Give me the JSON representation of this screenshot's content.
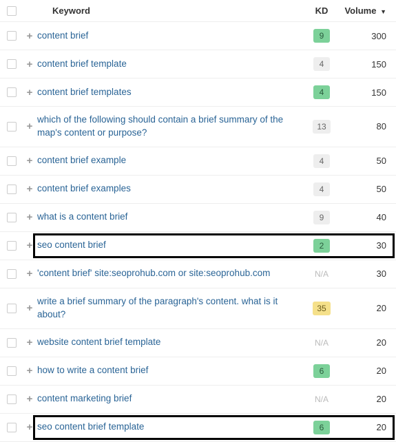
{
  "header": {
    "keyword_label": "Keyword",
    "kd_label": "KD",
    "volume_label": "Volume",
    "sort_indicator": "▼"
  },
  "kd_styles": {
    "green": "kd-green",
    "gray": "kd-gray",
    "yellow": "kd-yellow",
    "na": "kd-na"
  },
  "rows": [
    {
      "keyword": "content brief",
      "kd": "9",
      "kd_style": "green",
      "volume": "300",
      "highlighted": false
    },
    {
      "keyword": "content brief template",
      "kd": "4",
      "kd_style": "gray",
      "volume": "150",
      "highlighted": false
    },
    {
      "keyword": "content brief templates",
      "kd": "4",
      "kd_style": "green",
      "volume": "150",
      "highlighted": false
    },
    {
      "keyword": "which of the following should contain a brief summary of the map's content or purpose?",
      "kd": "13",
      "kd_style": "gray",
      "volume": "80",
      "highlighted": false
    },
    {
      "keyword": "content brief example",
      "kd": "4",
      "kd_style": "gray",
      "volume": "50",
      "highlighted": false
    },
    {
      "keyword": "content brief examples",
      "kd": "4",
      "kd_style": "gray",
      "volume": "50",
      "highlighted": false
    },
    {
      "keyword": "what is a content brief",
      "kd": "9",
      "kd_style": "gray",
      "volume": "40",
      "highlighted": false
    },
    {
      "keyword": "seo content brief",
      "kd": "2",
      "kd_style": "green",
      "volume": "30",
      "highlighted": true
    },
    {
      "keyword": "'content brief' site:seoprohub.com or site:seoprohub.com",
      "kd": "N/A",
      "kd_style": "na",
      "volume": "30",
      "highlighted": false
    },
    {
      "keyword": "write a brief summary of the paragraph's content. what is it about?",
      "kd": "35",
      "kd_style": "yellow",
      "volume": "20",
      "highlighted": false
    },
    {
      "keyword": "website content brief template",
      "kd": "N/A",
      "kd_style": "na",
      "volume": "20",
      "highlighted": false
    },
    {
      "keyword": "how to write a content brief",
      "kd": "6",
      "kd_style": "green",
      "volume": "20",
      "highlighted": false
    },
    {
      "keyword": "content marketing brief",
      "kd": "N/A",
      "kd_style": "na",
      "volume": "20",
      "highlighted": false
    },
    {
      "keyword": "seo content brief template",
      "kd": "6",
      "kd_style": "green",
      "volume": "20",
      "highlighted": true
    }
  ]
}
